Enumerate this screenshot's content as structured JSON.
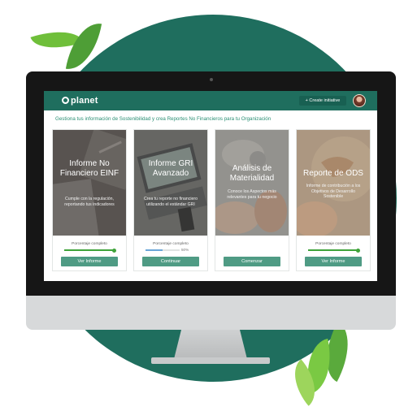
{
  "header": {
    "brand": "planet",
    "create_button": "Create initiative"
  },
  "subtitle": "Gestiona tus información de Sostenibilidad y crea Reportes No Financieros para tu Organización",
  "cards": [
    {
      "title": "Informe No Financiero EINF",
      "description": "Cumple con la regulación, reportando tus indicadores",
      "progress_label": "Porcentaje completo",
      "progress": 1.0,
      "button": "Ver Informe"
    },
    {
      "title": "Informe GRI Avanzado",
      "description": "Crea tu reporte no financiero utilizando el estándar GRI",
      "progress_label": "Porcentaje completo",
      "progress": 0.5,
      "progress_text": "50%",
      "button": "Continuar"
    },
    {
      "title": "Análisis de Materialidad",
      "description": "Conoce los Aspectos más relevantes para tu negocio",
      "button": "Comenzar"
    },
    {
      "title": "Reporte de ODS",
      "description": "Informe de contribución a los Objetivos de Desarrollo Sostenible",
      "progress_label": "Porcentaje completo",
      "progress": 1.0,
      "button": "Ver Informe"
    }
  ],
  "colors": {
    "brand_green": "#1f6e5e",
    "accent_green": "#2a8f74",
    "button_green": "#4f9b84",
    "progress_green": "#3fa33a",
    "progress_blue": "#6aa6d8"
  }
}
